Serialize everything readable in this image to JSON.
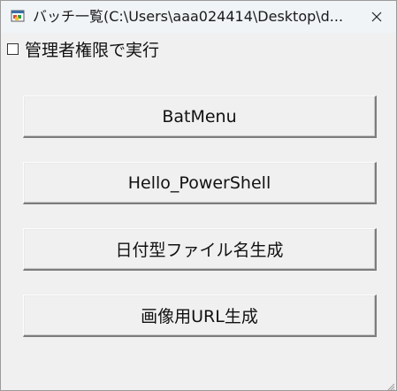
{
  "window": {
    "title": "バッチ一覧(C:\\Users\\aaa024414\\Desktop\\d...",
    "icon": "app-window-icon",
    "close_icon": "close-icon"
  },
  "options": {
    "run_as_admin_label": "管理者権限で実行",
    "run_as_admin_checked": false
  },
  "buttons": [
    {
      "label": "BatMenu"
    },
    {
      "label": "Hello_PowerShell"
    },
    {
      "label": "日付型ファイル名生成"
    },
    {
      "label": "画像用URL生成"
    }
  ],
  "colors": {
    "window_bg": "#f0f0f0",
    "titlebar_bg": "#f0f4f7"
  }
}
